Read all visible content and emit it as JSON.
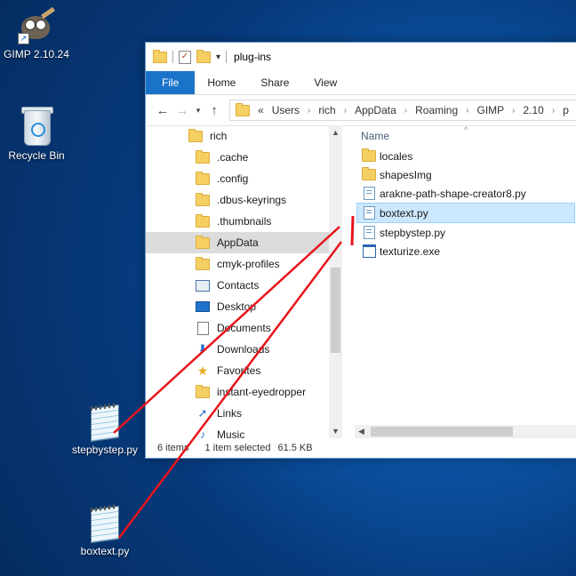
{
  "desktop": {
    "icons": [
      {
        "label": "GIMP 2.10.24",
        "icon": "gimp-icon"
      },
      {
        "label": "Recycle Bin",
        "icon": "recycle-bin-icon"
      },
      {
        "label": "stepbystep.py",
        "icon": "notepad-file-icon"
      },
      {
        "label": "boxtext.py",
        "icon": "notepad-file-icon"
      }
    ]
  },
  "window": {
    "title": "plug-ins",
    "ribbon_tabs": [
      "File",
      "Home",
      "Share",
      "View"
    ],
    "address": {
      "overflow": "«",
      "crumbs": [
        "Users",
        "rich",
        "AppData",
        "Roaming",
        "GIMP",
        "2.10",
        "p"
      ]
    },
    "nav_items": [
      {
        "label": "rich",
        "icon": "folder-icon"
      },
      {
        "label": ".cache",
        "icon": "folder-icon"
      },
      {
        "label": ".config",
        "icon": "folder-icon"
      },
      {
        "label": ".dbus-keyrings",
        "icon": "folder-icon"
      },
      {
        "label": ".thumbnails",
        "icon": "folder-icon"
      },
      {
        "label": "AppData",
        "icon": "folder-icon",
        "selected": true
      },
      {
        "label": "cmyk-profiles",
        "icon": "folder-icon"
      },
      {
        "label": "Contacts",
        "icon": "contacts-icon"
      },
      {
        "label": "Desktop",
        "icon": "desktop-icon"
      },
      {
        "label": "Documents",
        "icon": "documents-icon"
      },
      {
        "label": "Downloads",
        "icon": "downloads-icon"
      },
      {
        "label": "Favorites",
        "icon": "favorites-icon"
      },
      {
        "label": "instant-eyedropper",
        "icon": "folder-icon"
      },
      {
        "label": "Links",
        "icon": "links-icon"
      },
      {
        "label": "Music",
        "icon": "music-icon"
      }
    ],
    "column_header": "Name",
    "files": [
      {
        "name": "locales",
        "icon": "folder-icon"
      },
      {
        "name": "shapesImg",
        "icon": "folder-icon"
      },
      {
        "name": "arakne-path-shape-creator8.py",
        "icon": "python-file-icon"
      },
      {
        "name": "boxtext.py",
        "icon": "python-file-icon",
        "selected": true
      },
      {
        "name": "stepbystep.py",
        "icon": "python-file-icon"
      },
      {
        "name": "texturize.exe",
        "icon": "exe-file-icon"
      }
    ],
    "status": {
      "items": "6 items",
      "selected": "1 item selected",
      "size": "61.5 KB"
    }
  },
  "colors": {
    "accent": "#1a73c8",
    "selection": "#cce8ff",
    "annotation": "#e8141c"
  }
}
